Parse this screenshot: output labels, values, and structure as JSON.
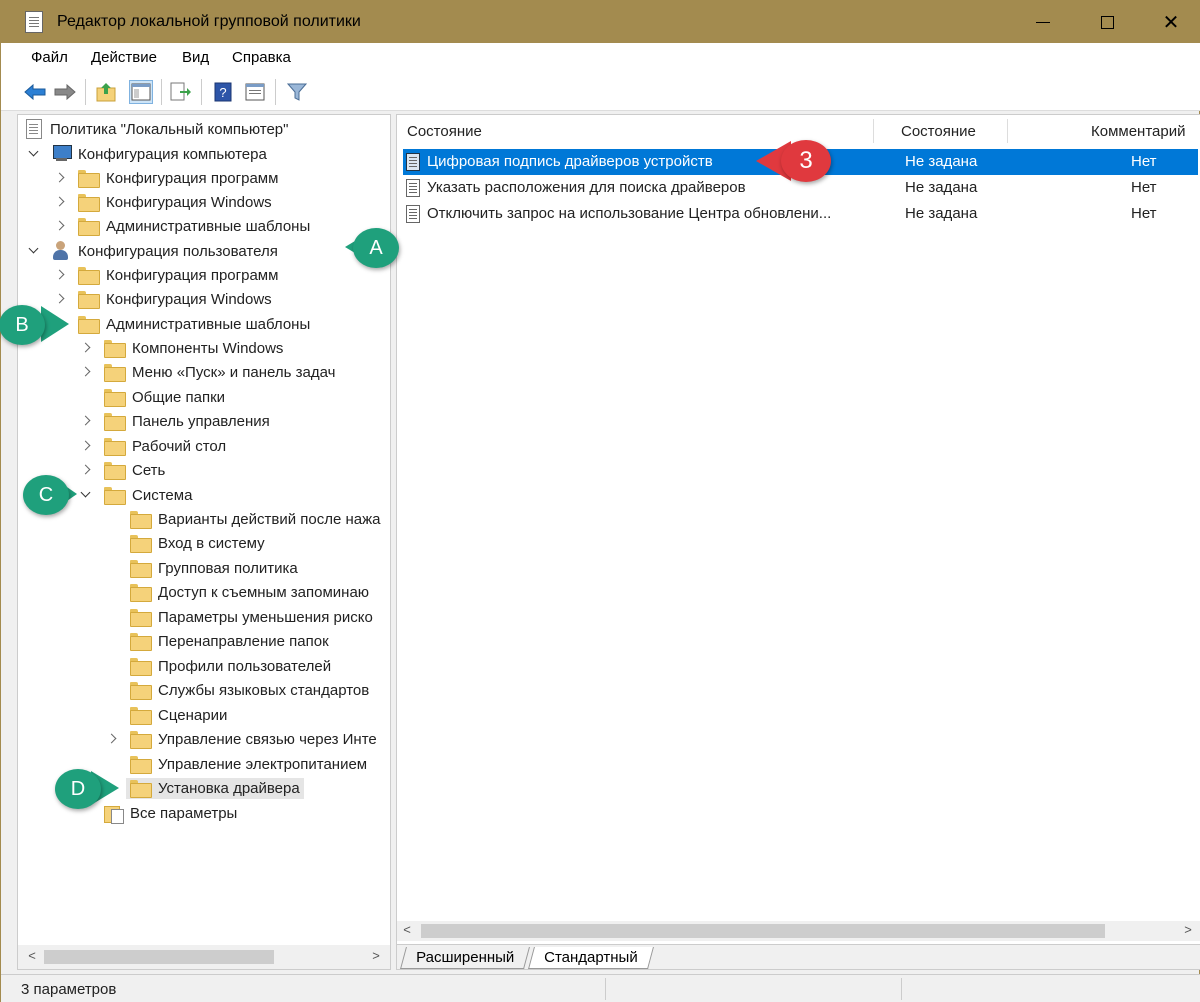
{
  "window": {
    "title": "Редактор локальной групповой политики"
  },
  "menu": [
    "Файл",
    "Действие",
    "Вид",
    "Справка"
  ],
  "toolbar": {
    "icons": [
      "back-arrow-icon",
      "forward-arrow-icon",
      "up-folder-icon",
      "show-hide-tree-icon",
      "export-list-icon",
      "help-icon",
      "properties-icon",
      "filter-icon"
    ]
  },
  "tree": {
    "root": "Политика \"Локальный компьютер\"",
    "computer_config": "Конфигурация компьютера",
    "cc_programs": "Конфигурация программ",
    "cc_windows": "Конфигурация Windows",
    "cc_admin": "Административные шаблоны",
    "user_config": "Конфигурация пользователя",
    "uc_programs": "Конфигурация программ",
    "uc_windows": "Конфигурация Windows",
    "uc_admin": "Административные шаблоны",
    "admin_children": [
      "Компоненты Windows",
      "Меню «Пуск» и панель задач",
      "Общие папки",
      "Панель управления",
      "Рабочий стол",
      "Сеть"
    ],
    "system": "Система",
    "system_children": [
      "Варианты действий после нажа",
      "Вход в систему",
      "Групповая политика",
      "Доступ к съемным запоминаю",
      "Параметры уменьшения риско",
      "Перенаправление папок",
      "Профили пользователей",
      "Службы языковых стандартов",
      "Сценарии",
      "Управление связью через Инте",
      "Управление электропитанием",
      "Установка драйвера"
    ],
    "all_params": "Все параметры"
  },
  "list": {
    "columns": [
      "Состояние",
      "Состояние",
      "Комментарий"
    ],
    "rows": [
      {
        "name": "Цифровая подпись драйверов устройств",
        "state": "Не задана",
        "comment": "Нет"
      },
      {
        "name": "Указать расположения для поиска драйверов",
        "state": "Не задана",
        "comment": "Нет"
      },
      {
        "name": "Отключить запрос на использование Центра обновлени...",
        "state": "Не задана",
        "comment": "Нет"
      }
    ]
  },
  "tabs": [
    "Расширенный",
    "Стандартный"
  ],
  "status": "3 параметров",
  "callouts": {
    "a": "A",
    "b": "B",
    "c": "C",
    "d": "D",
    "three": "3"
  },
  "colors": {
    "titlebar": "#a38b4f",
    "selection": "#0078d7",
    "callout_green": "#1fa07c",
    "callout_red": "#e0393e"
  }
}
